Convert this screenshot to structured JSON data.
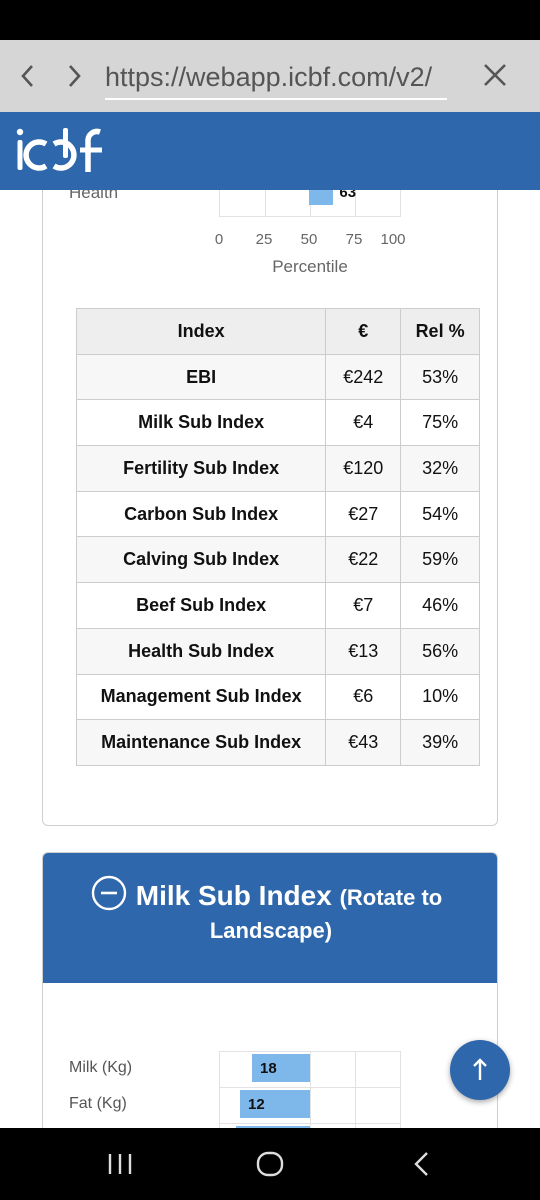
{
  "browser": {
    "url": "https://webapp.icbf.com/v2/"
  },
  "header": {
    "logo": "icbf"
  },
  "health_chart": {
    "row_label": "Health",
    "value": 63,
    "value_label": "63",
    "ticks": [
      "0",
      "25",
      "50",
      "75",
      "100"
    ],
    "axis_title": "Percentile",
    "bar_color": "#7eb7ea"
  },
  "index_table": {
    "headers": [
      "Index",
      "€",
      "Rel %"
    ],
    "rows": [
      {
        "name": "EBI",
        "eur": "€242",
        "rel": "53%"
      },
      {
        "name": "Milk Sub Index",
        "eur": "€4",
        "rel": "75%"
      },
      {
        "name": "Fertility Sub Index",
        "eur": "€120",
        "rel": "32%"
      },
      {
        "name": "Carbon Sub Index",
        "eur": "€27",
        "rel": "54%"
      },
      {
        "name": "Calving Sub Index",
        "eur": "€22",
        "rel": "59%"
      },
      {
        "name": "Beef Sub Index",
        "eur": "€7",
        "rel": "46%"
      },
      {
        "name": "Health Sub Index",
        "eur": "€13",
        "rel": "56%"
      },
      {
        "name": "Management Sub Index",
        "eur": "€6",
        "rel": "10%"
      },
      {
        "name": "Maintenance Sub Index",
        "eur": "€43",
        "rel": "39%"
      }
    ]
  },
  "milk_section": {
    "title": "Milk Sub Index",
    "title_suffix": "(Rotate to",
    "title_line2": "Landscape)",
    "rows": [
      {
        "label": "Milk (Kg)",
        "value": "18"
      },
      {
        "label": "Fat (Kg)",
        "value": "12"
      }
    ]
  },
  "colors": {
    "brand_blue": "#2e67ab",
    "bar_blue": "#7eb7ea"
  },
  "icons": {
    "back": "chevron-left-icon",
    "forward": "chevron-right-icon",
    "close": "close-icon",
    "collapse": "minus-circle-icon",
    "scroll_top": "arrow-up-icon",
    "recents": "recents-icon",
    "home": "home-icon",
    "nav_back": "back-icon"
  }
}
